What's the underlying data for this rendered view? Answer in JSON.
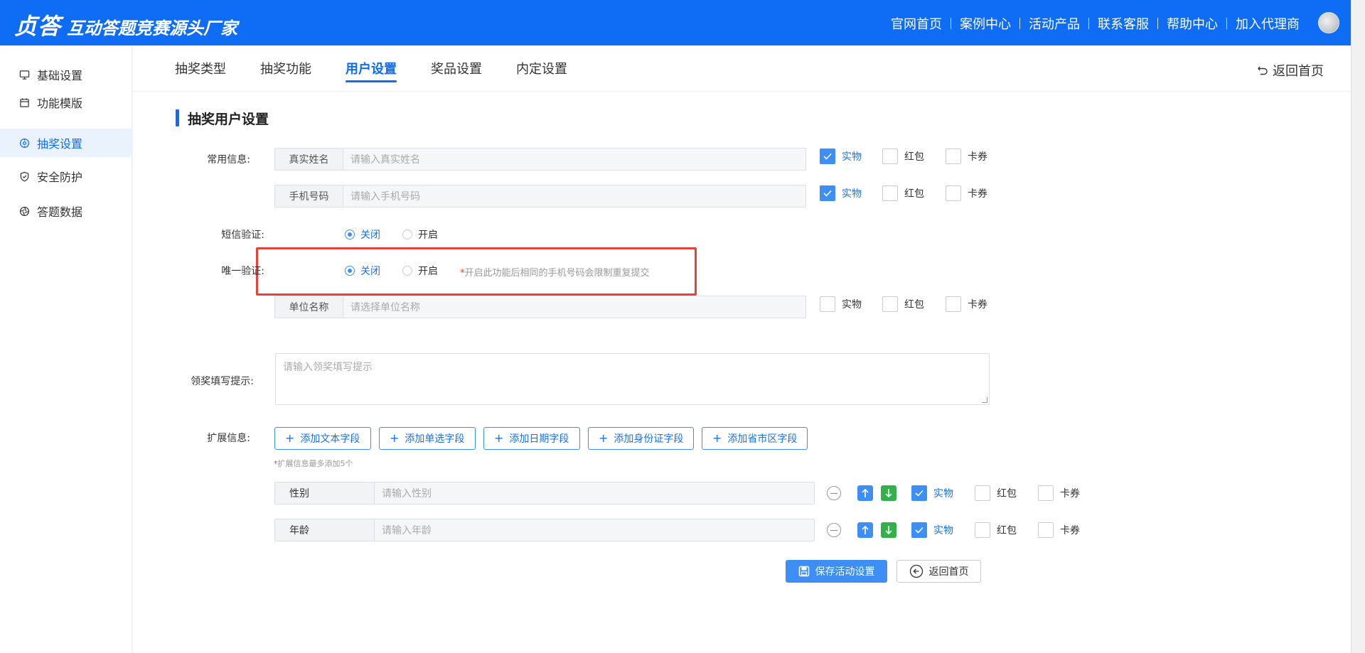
{
  "header": {
    "logo_main": "贞答",
    "logo_sub": "互动答题竞赛源头厂家",
    "nav": [
      "官网首页",
      "案例中心",
      "活动产品",
      "联系客服",
      "帮助中心",
      "加入代理商"
    ]
  },
  "sidebar": {
    "items": [
      {
        "label": "基础设置",
        "icon": "monitor-icon"
      },
      {
        "label": "功能模版",
        "icon": "calendar-icon"
      },
      {
        "label": "抽奖设置",
        "icon": "target-icon"
      },
      {
        "label": "安全防护",
        "icon": "shield-icon"
      },
      {
        "label": "答题数据",
        "icon": "aperture-icon"
      }
    ],
    "active_index": 2
  },
  "tabs": {
    "items": [
      "抽奖类型",
      "抽奖功能",
      "用户设置",
      "奖品设置",
      "内定设置"
    ],
    "active_index": 2,
    "back_home": "返回首页"
  },
  "section": {
    "title": "抽奖用户设置"
  },
  "common_info": {
    "label": "常用信息:",
    "fields": [
      {
        "prefix": "真实姓名",
        "placeholder": "请输入真实姓名",
        "physical": true,
        "redpacket": false,
        "coupon": false
      },
      {
        "prefix": "手机号码",
        "placeholder": "请输入手机号码",
        "physical": true,
        "redpacket": false,
        "coupon": false
      },
      {
        "prefix": "单位名称",
        "placeholder": "请选择单位名称",
        "physical": false,
        "redpacket": false,
        "coupon": false
      }
    ]
  },
  "prize_options": {
    "physical": "实物",
    "redpacket": "红包",
    "coupon": "卡券"
  },
  "sms_verify": {
    "label": "短信验证:",
    "off": "关闭",
    "on": "开启",
    "selected": "off"
  },
  "unique_verify": {
    "label": "唯一验证:",
    "off": "关闭",
    "on": "开启",
    "selected": "off",
    "hint_star": "*",
    "hint": "开启此功能后相同的手机号码会限制重复提交"
  },
  "claim_hint": {
    "label": "领奖填写提示:",
    "placeholder": "请输入领奖填写提示"
  },
  "extended_info": {
    "label": "扩展信息:",
    "buttons": [
      "添加文本字段",
      "添加单选字段",
      "添加日期字段",
      "添加身份证字段",
      "添加省市区字段"
    ],
    "limit_star": "*",
    "limit_hint": "扩展信息最多添加5个",
    "fields": [
      {
        "name": "性别",
        "placeholder": "请输入性别",
        "physical": true,
        "redpacket": false,
        "coupon": false
      },
      {
        "name": "年龄",
        "placeholder": "请输入年龄",
        "physical": true,
        "redpacket": false,
        "coupon": false
      }
    ]
  },
  "actions": {
    "save": "保存活动设置",
    "back": "返回首页"
  },
  "colors": {
    "primary": "#0e6cf5",
    "accent": "#3e8ff5",
    "green": "#33b04a",
    "danger": "#e5423a"
  }
}
